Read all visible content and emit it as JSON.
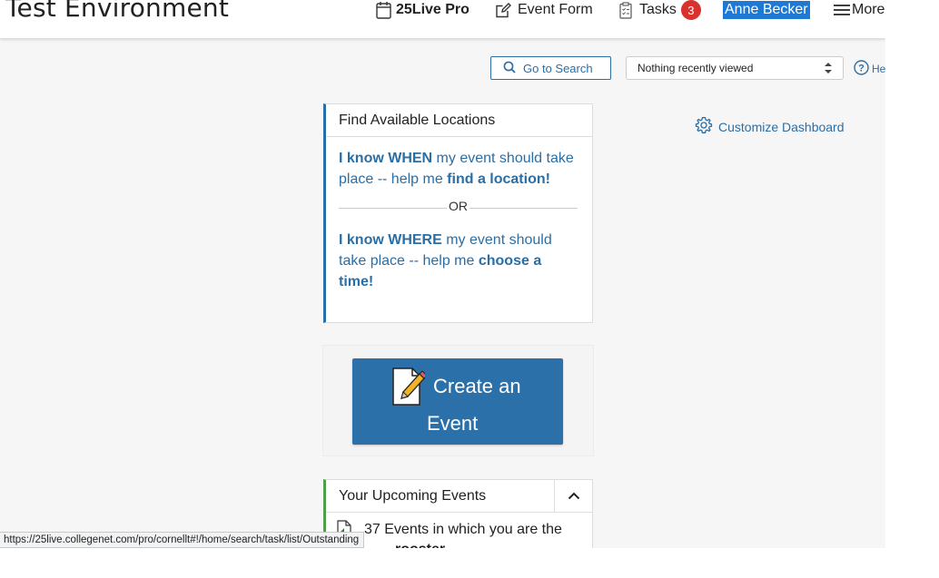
{
  "header": {
    "title": "Test Environment",
    "nav": {
      "product": "25Live Pro",
      "event_form": "Event Form",
      "tasks": "Tasks",
      "tasks_count": "3",
      "user": "Anne Becker",
      "more": "More"
    }
  },
  "toolbar": {
    "search_button": "Go to Search",
    "recent_select": "Nothing recently viewed",
    "help": "He"
  },
  "dashboard": {
    "customize": "Customize Dashboard"
  },
  "locations_card": {
    "title": "Find Available Locations",
    "when_b1": "I know WHEN",
    "when_t1": " my event should take place -- help me ",
    "when_b2": "find a location!",
    "or": "OR",
    "where_b1": "I know WHERE",
    "where_t1": " my event should take place -- help me ",
    "where_b2": "choose a time!"
  },
  "create_card": {
    "line1": "Create an",
    "line2": "Event"
  },
  "upcoming_card": {
    "title": "Your Upcoming Events",
    "row_text": "37 Events in which you are the",
    "row_text2": "rooster"
  },
  "statusbar": {
    "url": "https://25live.collegenet.com/pro/cornellt#!/home/search/task/list/Outstanding"
  },
  "colors": {
    "accent": "#2a6ea6",
    "button": "#2b70a8",
    "user_highlight": "#1e78d6",
    "badge": "#d9312b",
    "upcoming_border": "#4e9e4a"
  }
}
